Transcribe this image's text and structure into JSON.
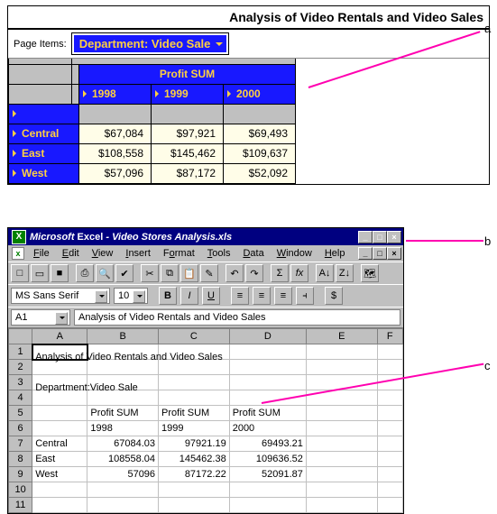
{
  "pivot": {
    "title": "Analysis of Video Rentals and Video Sales",
    "page_items_label": "Page Items:",
    "page_value": "Department: Video Sale",
    "sum_header": "Profit SUM",
    "years": [
      "1998",
      "1999",
      "2000"
    ],
    "rows": [
      {
        "name": "Central",
        "values": [
          "$67,084",
          "$97,921",
          "$69,493"
        ]
      },
      {
        "name": "East",
        "values": [
          "$108,558",
          "$145,462",
          "$109,637"
        ]
      },
      {
        "name": "West",
        "values": [
          "$57,096",
          "$87,172",
          "$52,092"
        ]
      }
    ]
  },
  "excel": {
    "title_app": "Microsoft",
    "title_app2": " Excel",
    "title_doc": " - Video Stores Analysis.xls",
    "menu": [
      "File",
      "Edit",
      "View",
      "Insert",
      "Format",
      "Tools",
      "Data",
      "Window",
      "Help"
    ],
    "font_name": "MS Sans Serif",
    "font_size": "10",
    "cell_ref": "A1",
    "formula_value": "Analysis of Video Rentals and Video Sales",
    "columns": [
      "A",
      "B",
      "C",
      "D",
      "E",
      "F"
    ],
    "cells": {
      "A1": "Analysis of Video Rentals and Video Sales",
      "A3": "Department:Video Sale",
      "B5": "Profit SUM",
      "C5": "Profit SUM",
      "D5": "Profit SUM",
      "B6": "1998",
      "C6": "1999",
      "D6": "2000",
      "A7": "Central",
      "B7": "67084.03",
      "C7": "97921.19",
      "D7": "69493.21",
      "A8": "East",
      "B8": "108558.04",
      "C8": "145462.38",
      "D8": "109636.52",
      "A9": "West",
      "B9": "57096",
      "C9": "87172.22",
      "D9": "52091.87"
    }
  },
  "annotations": {
    "a": "a",
    "b": "b",
    "c": "c"
  },
  "icons": {
    "min": "_",
    "max": "□",
    "close": "×",
    "new": "□",
    "open": "▭",
    "save": "■",
    "print": "⎙",
    "preview": "🔍",
    "spell": "✔",
    "cut": "✂",
    "copy": "⧉",
    "paste": "📋",
    "fmtpaint": "✎",
    "undo": "↶",
    "redo": "↷",
    "sum": "Σ",
    "fx": "fx",
    "sortA": "A↓",
    "sortZ": "Z↓",
    "bold": "B",
    "italic": "I",
    "underline": "U",
    "alignL": "≡",
    "alignC": "≡",
    "alignR": "≡",
    "merge": "⫞",
    "currency": "$",
    "map": "🗺"
  }
}
